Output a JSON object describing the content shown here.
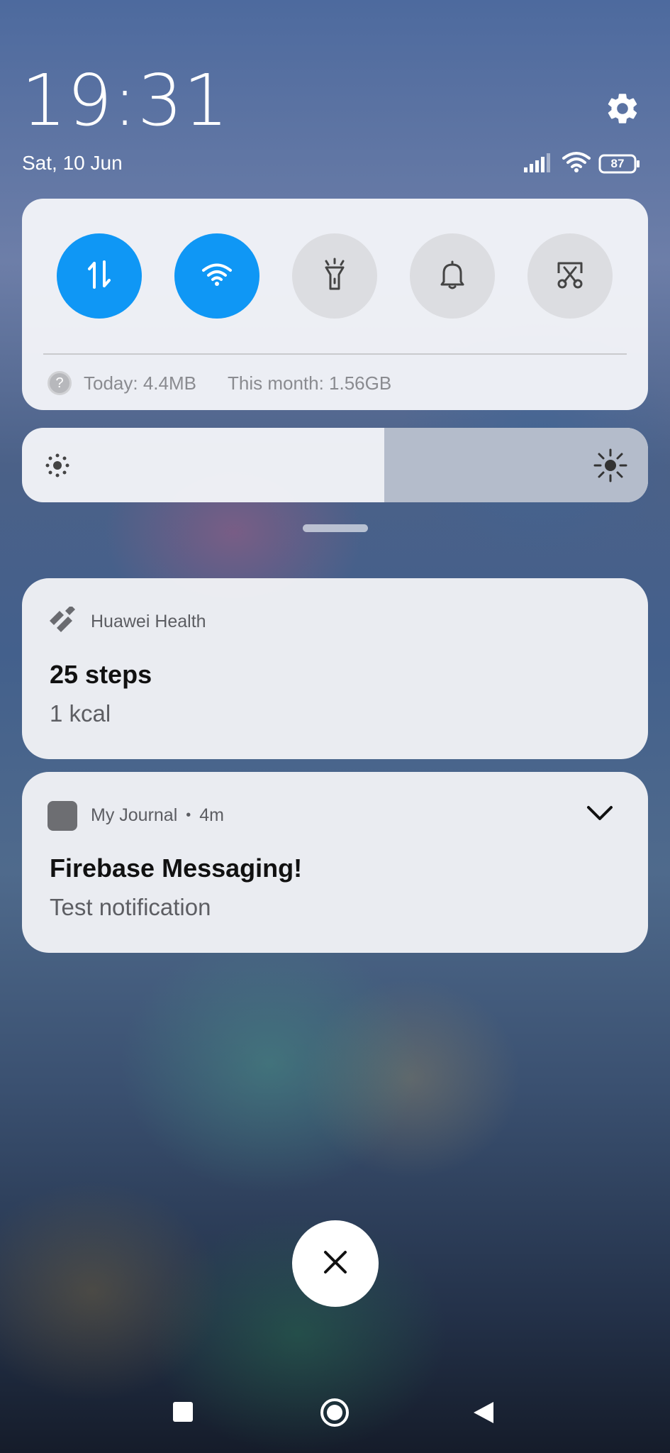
{
  "status": {
    "time": "19:31",
    "date": "Sat, 10 Jun",
    "battery": "87",
    "icons": [
      "signal-icon",
      "wifi-icon",
      "battery-icon"
    ]
  },
  "quick_settings": {
    "toggles": [
      {
        "name": "mobile-data-toggle",
        "icon": "data-transfer-icon",
        "state": "on"
      },
      {
        "name": "wifi-toggle",
        "icon": "wifi-icon",
        "state": "on"
      },
      {
        "name": "flashlight-toggle",
        "icon": "flashlight-icon",
        "state": "off"
      },
      {
        "name": "sound-toggle",
        "icon": "bell-icon",
        "state": "off"
      },
      {
        "name": "screenshot-toggle",
        "icon": "scissors-icon",
        "state": "off"
      }
    ],
    "today_usage": "Today: 4.4MB",
    "month_usage": "This month: 1.56GB"
  },
  "brightness": {
    "level": 0.45
  },
  "notifications": [
    {
      "app": "Huawei Health",
      "time": "",
      "title": "25 steps",
      "body": "1 kcal"
    },
    {
      "app": "My Journal",
      "time": "4m",
      "title": "Firebase Messaging!",
      "body": "Test notification"
    }
  ],
  "colors": {
    "accent": "#0f97f5",
    "toggle_off": "#dcdde1"
  }
}
